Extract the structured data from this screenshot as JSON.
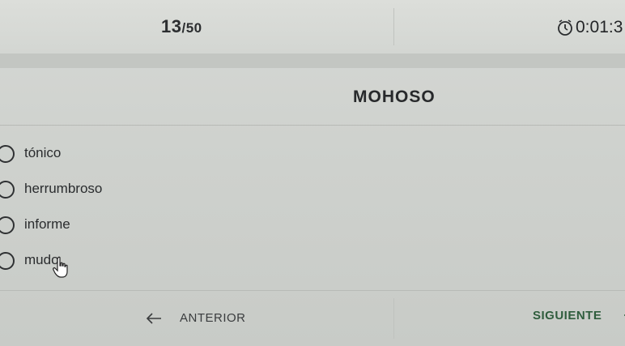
{
  "header": {
    "counter_current": "13",
    "counter_total": "/50",
    "timer_text": "0:01:3"
  },
  "question": {
    "word": "MOHOSO"
  },
  "options": [
    {
      "label": "tónico"
    },
    {
      "label": "herrumbroso"
    },
    {
      "label": "informe"
    },
    {
      "label": "mudo"
    }
  ],
  "footer": {
    "prev_label": "ANTERIOR",
    "next_label": "SIGUIENTE"
  },
  "colors": {
    "next_text": "#2f5d3d",
    "background": "#cfd2ce"
  },
  "icons": {
    "timer": "stopwatch-icon",
    "prev": "arrow-left-icon",
    "next": "arrow-right-icon",
    "pointer": "hand-pointer-icon"
  }
}
